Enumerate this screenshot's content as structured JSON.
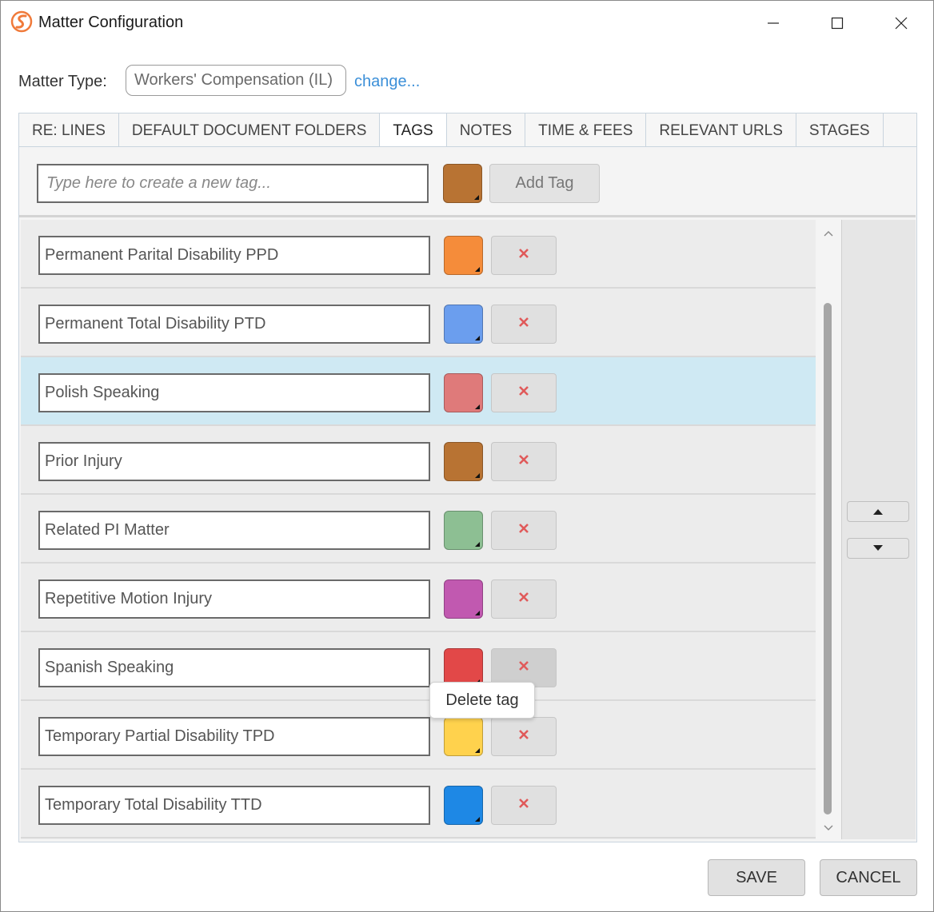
{
  "window": {
    "title": "Matter Configuration",
    "icon": "app-logo-icon",
    "controls": [
      "minimize-icon",
      "maximize-icon",
      "close-icon"
    ]
  },
  "matter_type": {
    "label": "Matter Type:",
    "value": "Workers' Compensation (IL)",
    "change_link": "change..."
  },
  "tabs": [
    {
      "label": "RE: LINES",
      "active": false
    },
    {
      "label": "DEFAULT DOCUMENT FOLDERS",
      "active": false
    },
    {
      "label": "TAGS",
      "active": true
    },
    {
      "label": "NOTES",
      "active": false
    },
    {
      "label": "TIME & FEES",
      "active": false
    },
    {
      "label": "RELEVANT URLS",
      "active": false
    },
    {
      "label": "STAGES",
      "active": false
    }
  ],
  "new_tag": {
    "placeholder": "Type here to create a new tag...",
    "color": "#b87333",
    "add_label": "Add Tag"
  },
  "tags": [
    {
      "name": "Permanent Parital Disability PPD",
      "color": "#f58c3a",
      "selected": false
    },
    {
      "name": "Permanent Total Disability PTD",
      "color": "#6b9eee",
      "selected": false
    },
    {
      "name": "Polish Speaking",
      "color": "#df7a7a",
      "selected": true
    },
    {
      "name": "Prior Injury",
      "color": "#b87333",
      "selected": false
    },
    {
      "name": "Related PI Matter",
      "color": "#8dbf93",
      "selected": false
    },
    {
      "name": "Repetitive Motion Injury",
      "color": "#c159b0",
      "selected": false
    },
    {
      "name": "Spanish Speaking",
      "color": "#e24848",
      "selected": false
    },
    {
      "name": "Temporary Partial Disability TPD",
      "color": "#ffd24d",
      "selected": false
    },
    {
      "name": "Temporary Total Disability TTD",
      "color": "#1e88e5",
      "selected": false
    }
  ],
  "delete_color": "#e05a5a",
  "tooltip": "Delete tag",
  "footer": {
    "save_label": "SAVE",
    "cancel_label": "CANCEL"
  }
}
